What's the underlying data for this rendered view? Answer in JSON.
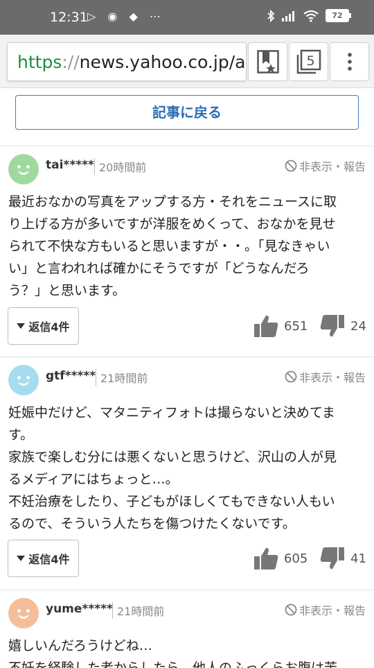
{
  "status": {
    "time": "12:31",
    "battery": "72"
  },
  "browser": {
    "scheme": "https",
    "sep": "://",
    "host": "news.yahoo.co.jp/a...",
    "tab_count": "5"
  },
  "back_button": "記事に戻る",
  "comments": [
    {
      "user": "tai*****",
      "time": "20時間前",
      "hide_report": "非表示・報告",
      "avatar_color": "#9fd9a0",
      "lines": [
        "最近おなかの写真をアップする方・それをニュースに取",
        "り上げる方が多いですが洋服をめくって、おなかを見せ",
        "られて不快な方もいると思いますが・・。「見なきゃい",
        "い」と言われれば確かにそうですが「どうなんだろ",
        "う？」と思います。"
      ],
      "reply_label": "返信4件",
      "likes": "651",
      "dislikes": "24"
    },
    {
      "user": "gtf*****",
      "time": "21時間前",
      "hide_report": "非表示・報告",
      "avatar_color": "#a6dcef",
      "lines": [
        "妊娠中だけど、マタニティフォトは撮らないと決めてま",
        "す。",
        "家族で楽しむ分には悪くないと思うけど、沢山の人が見",
        "るメディアにはちょっと…。",
        "不妊治療をしたり、子どもがほしくてもできない人もい",
        "るので、そういう人たちを傷つけたくないです。"
      ],
      "reply_label": "返信4件",
      "likes": "605",
      "dislikes": "41"
    },
    {
      "user": "yume*****",
      "time": "21時間前",
      "hide_report": "非表示・報告",
      "avatar_color": "#f4bf98",
      "lines": [
        "嬉しいんだろうけどね…",
        "不妊を経験した者からしたら、他人のふっくらお腹は苦"
      ]
    }
  ]
}
